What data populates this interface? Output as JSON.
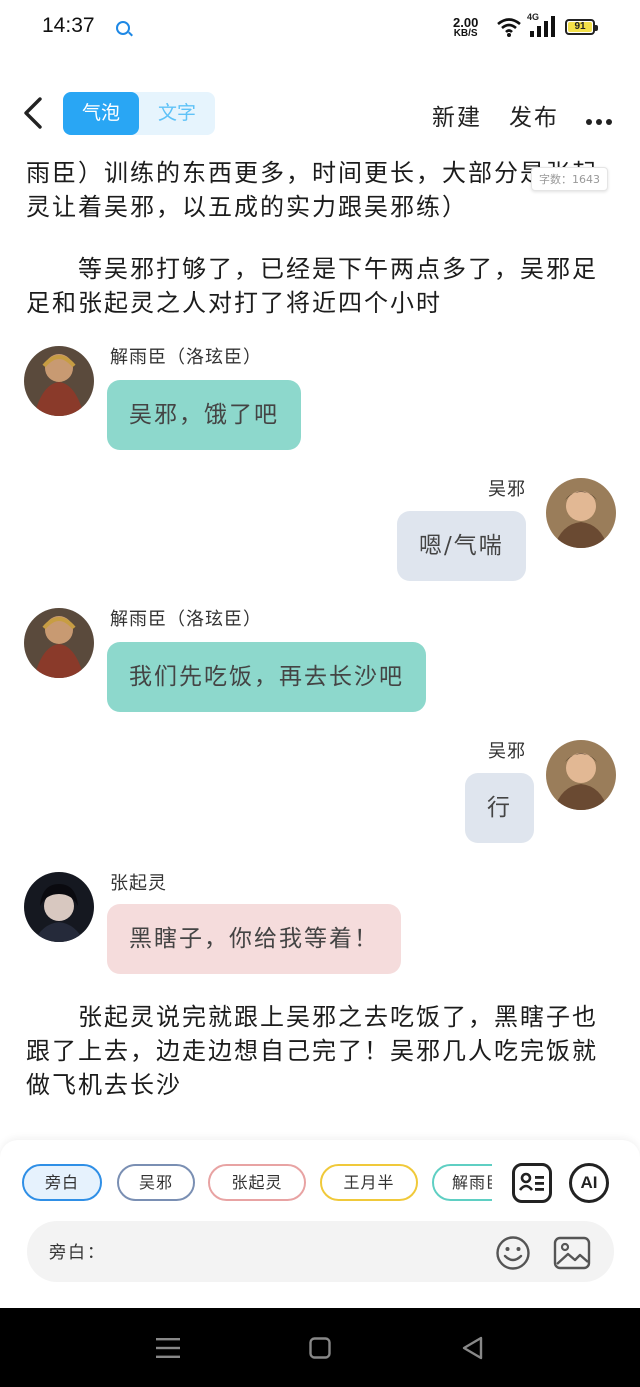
{
  "status_bar": {
    "time": "14:37",
    "net_speed": "2.00",
    "net_unit": "KB/S",
    "signal": "4G",
    "battery": "91"
  },
  "header": {
    "tab_bubble": "气泡",
    "tab_text": "文字",
    "new_label": "新建",
    "publish_label": "发布"
  },
  "word_count": "字数：1643",
  "paragraphs": [
    "雨臣）训练的东西更多，时间更长，大部分是张起灵让着吴邪，以五成的实力跟吴邪练）",
    "　　等吴邪打够了，已经是下午两点多了，吴邪足足和张起灵之人对打了将近四个小时",
    "　　张起灵说完就跟上吴邪之去吃饭了，黑瞎子也跟了上去，边走边想自己完了！吴邪几人吃完饭就做飞机去长沙"
  ],
  "messages": [
    {
      "name": "解雨臣（洛玹臣）",
      "text": "吴邪，饿了吧",
      "side": "left",
      "color": "#8dd8cc"
    },
    {
      "name": "吴邪",
      "text": "嗯/气喘",
      "side": "right",
      "color": "#dfe5ee"
    },
    {
      "name": "解雨臣（洛玹臣）",
      "text": "我们先吃饭，再去长沙吧",
      "side": "left",
      "color": "#8dd8cc"
    },
    {
      "name": "吴邪",
      "text": "行",
      "side": "right",
      "color": "#dfe5ee"
    },
    {
      "name": "张起灵",
      "text": "黑瞎子，你给我等着！",
      "side": "left",
      "color": "#f5dcdc"
    }
  ],
  "characters": [
    {
      "label": "旁白",
      "color": "#2f8fe6"
    },
    {
      "label": "吴邪",
      "color": "#7a8fb3"
    },
    {
      "label": "张起灵",
      "color": "#e8a3a3"
    },
    {
      "label": "王月半",
      "color": "#f0c93a"
    },
    {
      "label": "解雨臣",
      "color": "#5fcfc3"
    }
  ],
  "tools": {
    "ai_label": "AI"
  },
  "input": {
    "label": "旁白："
  }
}
